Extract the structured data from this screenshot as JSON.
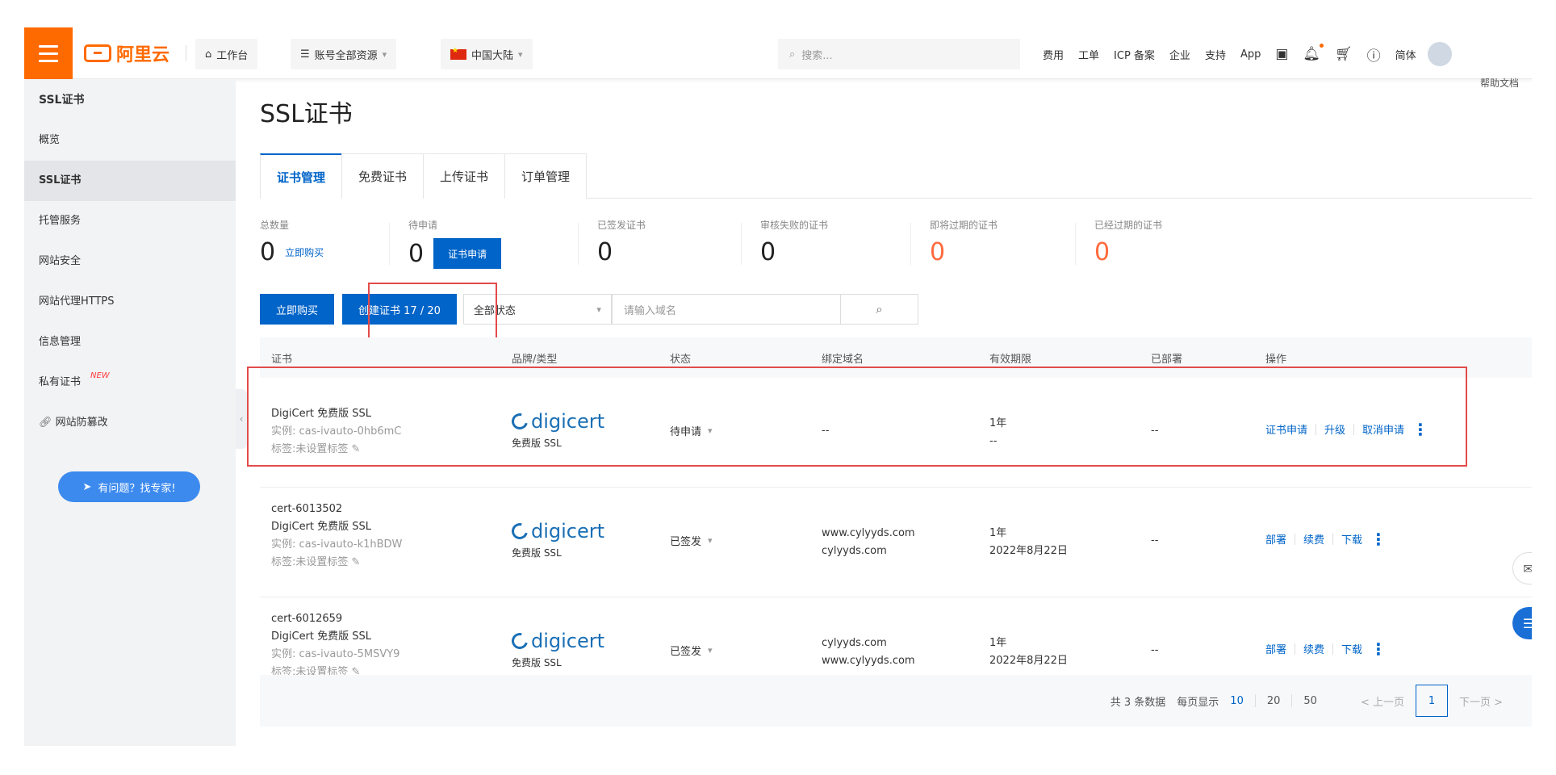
{
  "topbar": {
    "brand": "阿里云",
    "workbench": "工作台",
    "resources": "账号全部资源",
    "region": "中国大陆",
    "search_placeholder": "搜索...",
    "nav": [
      "费用",
      "工单",
      "ICP 备案",
      "企业",
      "支持",
      "App"
    ],
    "lang": "简体",
    "help_docs": "帮助文档"
  },
  "sidebar": {
    "title": "SSL证书",
    "items": [
      {
        "label": "概览"
      },
      {
        "label": "SSL证书"
      },
      {
        "label": "托管服务"
      },
      {
        "label": "网站安全"
      },
      {
        "label": "网站代理HTTPS"
      },
      {
        "label": "信息管理"
      },
      {
        "label": "私有证书",
        "tag": "NEW"
      },
      {
        "label": "网站防篡改"
      }
    ],
    "expert_button": "有问题？找专家!"
  },
  "page": {
    "title": "SSL证书",
    "tabs": [
      "证书管理",
      "免费证书",
      "上传证书",
      "订单管理"
    ]
  },
  "stats": [
    {
      "label": "总数量",
      "value": "0",
      "link": "立即购买"
    },
    {
      "label": "待申请",
      "value": "0",
      "button": "证书申请"
    },
    {
      "label": "已签发证书",
      "value": "0"
    },
    {
      "label": "审核失败的证书",
      "value": "0"
    },
    {
      "label": "即将过期的证书",
      "value": "0"
    },
    {
      "label": "已经过期的证书",
      "value": "0"
    }
  ],
  "toolbar": {
    "buy_button": "立即购买",
    "create_button": "创建证书 17 / 20",
    "status_select": "全部状态",
    "domain_placeholder": "请输入域名"
  },
  "table": {
    "headers": [
      "证书",
      "品牌/类型",
      "状态",
      "绑定域名",
      "有效期限",
      "已部署",
      "操作"
    ],
    "rows": [
      {
        "name": "",
        "product": "DigiCert 免费版 SSL",
        "instance": "实例: cas-ivauto-0hb6mC",
        "tags": "标签:未设置标签",
        "brand": "digicert",
        "brand_type": "免费版 SSL",
        "status": "待申请",
        "domains": [
          "--"
        ],
        "validity": [
          "1年",
          "--"
        ],
        "deployed": "--",
        "actions": [
          "证书申请",
          "升级",
          "取消申请"
        ]
      },
      {
        "name": "cert-6013502",
        "product": "DigiCert 免费版 SSL",
        "instance": "实例: cas-ivauto-k1hBDW",
        "tags": "标签:未设置标签",
        "brand": "digicert",
        "brand_type": "免费版 SSL",
        "status": "已签发",
        "domains": [
          "www.cylyyds.com",
          "cylyyds.com"
        ],
        "validity": [
          "1年",
          "2022年8月22日"
        ],
        "deployed": "--",
        "actions": [
          "部署",
          "续费",
          "下载"
        ]
      },
      {
        "name": "cert-6012659",
        "product": "DigiCert 免费版 SSL",
        "instance": "实例: cas-ivauto-5MSVY9",
        "tags": "标签:未设置标签",
        "brand": "digicert",
        "brand_type": "免费版 SSL",
        "status": "已签发",
        "domains": [
          "cylyyds.com",
          "www.cylyyds.com"
        ],
        "validity": [
          "1年",
          "2022年8月22日"
        ],
        "deployed": "--",
        "actions": [
          "部署",
          "续费",
          "下载"
        ]
      }
    ]
  },
  "pagination": {
    "total": "共 3 条数据",
    "per_page_label": "每页显示",
    "sizes": [
      "10",
      "20",
      "50"
    ],
    "prev": "< 上一页",
    "current": "1",
    "next": "下一页 >"
  },
  "colors": {
    "brand_orange": "#ff6a00",
    "primary_blue": "#0064c8",
    "highlight_red": "#e34b4b",
    "warning_orange": "#ff6a3d"
  }
}
